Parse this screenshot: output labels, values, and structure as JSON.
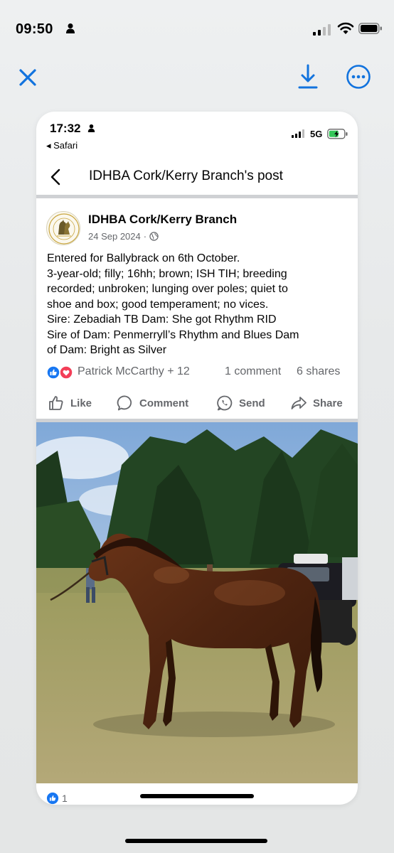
{
  "status_bar": {
    "time": "09:50"
  },
  "toolbar": {
    "close_icon": "close-icon",
    "download_icon": "download-icon",
    "more_icon": "more-icon",
    "accent": "#1273de"
  },
  "inner_status": {
    "time": "17:32",
    "back_app": "◂ Safari",
    "network": "5G"
  },
  "post_header": {
    "title": "IDHBA Cork/Kerry Branch's post"
  },
  "post": {
    "author": "IDHBA Cork/Kerry Branch",
    "date": "24 Sep 2024",
    "separator": "·",
    "lines": [
      "Entered for Ballybrack on 6th October.",
      "3-year-old; filly; 16hh; brown; ISH TIH; breeding",
      "recorded; unbroken; lunging over poles; quiet to",
      "shoe and box; good temperament; no vices.",
      "Sire: Zebadiah TB  Dam: She got Rhythm RID",
      "Sire of Dam: Penmerryll’s Rhythm and Blues Dam",
      "of Dam: Bright as Silver"
    ],
    "reactors": "Patrick McCarthy + 12",
    "comments": "1 comment",
    "shares": "6 shares"
  },
  "actions": {
    "like": "Like",
    "comment": "Comment",
    "send": "Send",
    "share": "Share"
  },
  "footer": {
    "like_count": "1"
  },
  "colors": {
    "fb_blue": "#1877f2",
    "love_red": "#f33e58",
    "muted_text": "#65676b"
  }
}
